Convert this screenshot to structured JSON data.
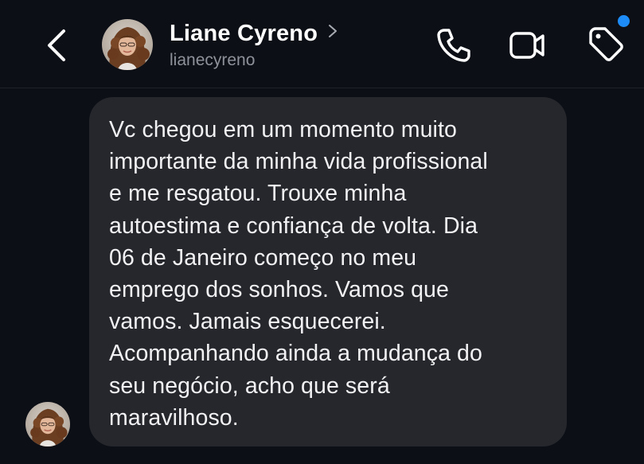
{
  "header": {
    "contact_name": "Liane Cyreno",
    "username": "lianecyreno",
    "icons": {
      "back": "chevron-left-icon",
      "profile_link": "chevron-right-icon",
      "call": "phone-icon",
      "video": "video-camera-icon",
      "tag": "tag-icon"
    },
    "has_notification_dot": true
  },
  "colors": {
    "background": "#0c0f16",
    "bubble": "#25272c",
    "accent_dot": "#1d8cf8",
    "secondary_text": "#8e9199"
  },
  "messages": [
    {
      "sender": "Liane Cyreno",
      "text": "Vc chegou em um momento muito\nimportante da minha vida profissional\ne me resgatou. Trouxe minha\nautoestima e confiança de volta. Dia\n06 de Janeiro começo no meu\nemprego dos sonhos. Vamos que\nvamos. Jamais esquecerei.\nAcompanhando ainda a mudança do\nseu negócio, acho que será\nmaravilhoso."
    }
  ]
}
